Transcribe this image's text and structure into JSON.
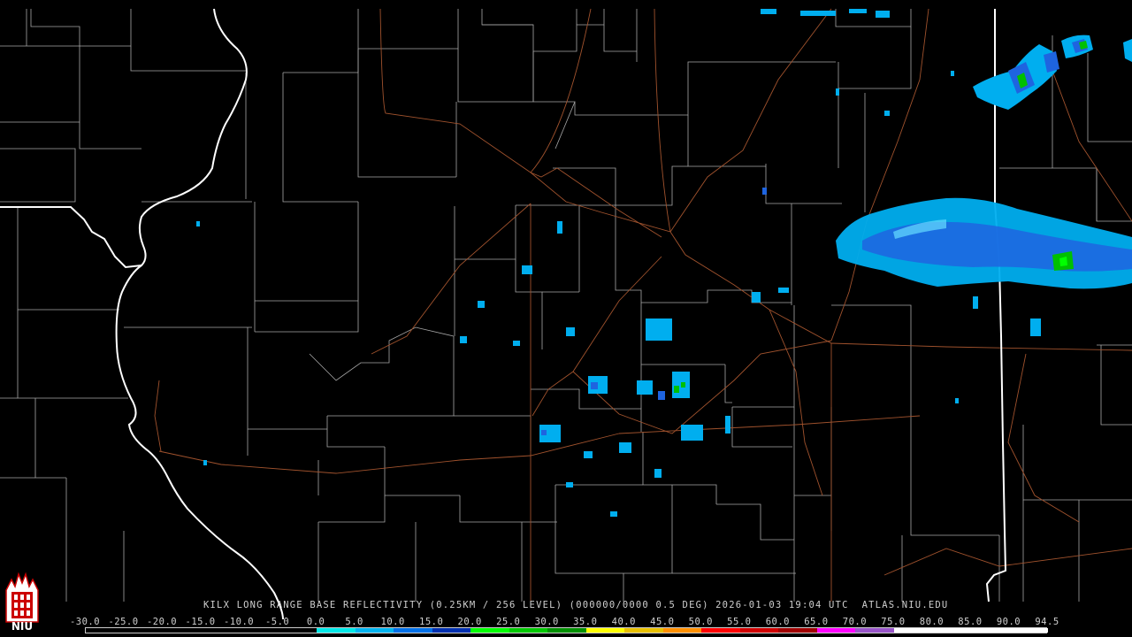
{
  "caption": "KILX LONG RANGE BASE REFLECTIVITY (0.25KM / 256 LEVEL) (000000/0000 0.5 DEG) 2026-01-03 19:04 UTC  ATLAS.NIU.EDU",
  "logo_text": "NIU",
  "scale": {
    "labels": [
      "-30.0",
      "-25.0",
      "-20.0",
      "-15.0",
      "-10.0",
      "-5.0",
      "0.0",
      "5.0",
      "10.0",
      "15.0",
      "20.0",
      "25.0",
      "30.0",
      "35.0",
      "40.0",
      "45.0",
      "50.0",
      "55.0",
      "60.0",
      "65.0",
      "70.0",
      "75.0",
      "80.0",
      "85.0",
      "90.0",
      "94.5"
    ],
    "colors": [
      "#000000",
      "#000000",
      "#000000",
      "#000000",
      "#000000",
      "#000000",
      "#00e8e8",
      "#00b4f0",
      "#0070e8",
      "#0030b0",
      "#00ff00",
      "#00c800",
      "#009000",
      "#ffff00",
      "#e8c000",
      "#ff9000",
      "#ff0000",
      "#d00000",
      "#a00000",
      "#ff00ff",
      "#9955c9",
      "#ffffff",
      "#ffffff",
      "#ffffff",
      "#ffffff"
    ]
  },
  "colors": {
    "state_border": "#ffffff",
    "county_border": "#a8a8a8",
    "highway": "#a0522d",
    "background": "#000000"
  }
}
